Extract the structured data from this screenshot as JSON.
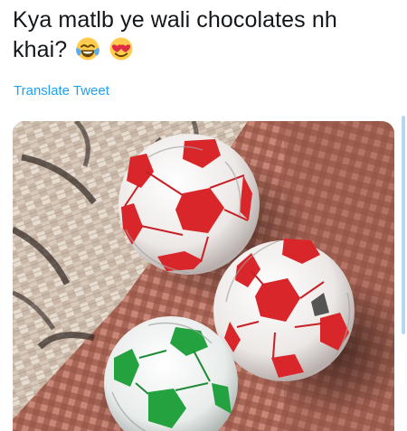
{
  "tweet": {
    "text": "Kya matlb ye wali chocolates nh khai?",
    "emojis": [
      "face-with-tears-of-joy",
      "smiling-face-with-heart-eyes"
    ],
    "translate_label": "Translate Tweet"
  },
  "media": {
    "description_icon": "photo"
  },
  "colors": {
    "link": "#1da1f2",
    "text": "#14171a",
    "red_wrapper": "#d9262a",
    "green_wrapper": "#23a23f"
  }
}
